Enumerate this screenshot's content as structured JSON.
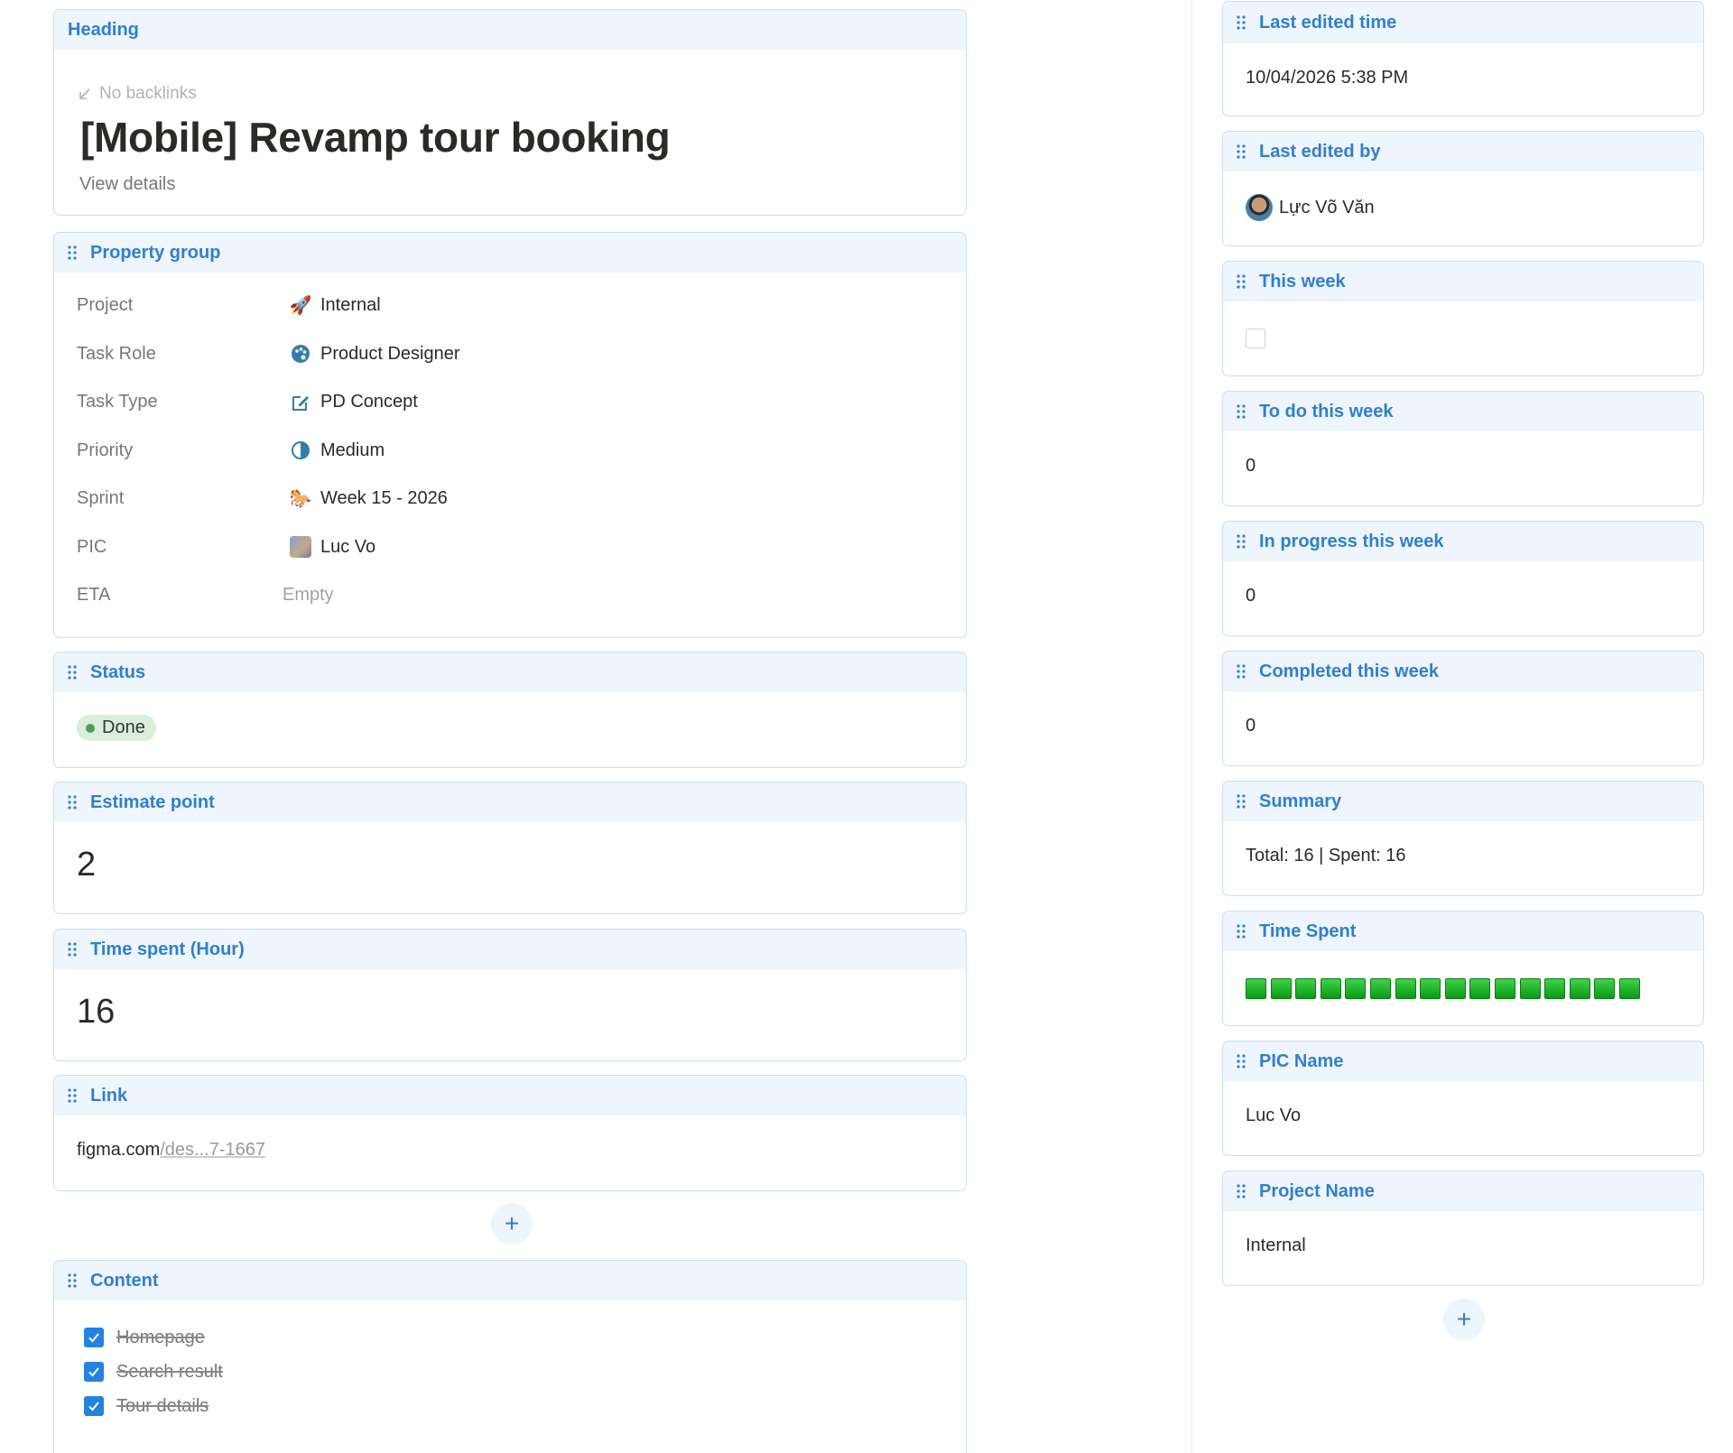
{
  "heading_card": {
    "label": "Heading",
    "backlinks_text": "No backlinks",
    "title": "[Mobile] Revamp tour booking",
    "view_details": "View details"
  },
  "property_group": {
    "label": "Property group",
    "rows": [
      {
        "label": "Project",
        "value": "Internal",
        "icon": "rocket-icon"
      },
      {
        "label": "Task Role",
        "value": "Product Designer",
        "icon": "palette-icon"
      },
      {
        "label": "Task Type",
        "value": "PD Concept",
        "icon": "edit-icon"
      },
      {
        "label": "Priority",
        "value": "Medium",
        "icon": "half-circle-icon"
      },
      {
        "label": "Sprint",
        "value": "Week 15 - 2026",
        "icon": "horse-icon"
      },
      {
        "label": "PIC",
        "value": "Luc Vo",
        "icon": "avatar"
      },
      {
        "label": "ETA",
        "value": "Empty",
        "icon": ""
      }
    ]
  },
  "status": {
    "label": "Status",
    "value": "Done",
    "color": "#dbeddb"
  },
  "estimate": {
    "label": "Estimate point",
    "value": "2"
  },
  "time_spent": {
    "label": "Time spent (Hour)",
    "value": "16"
  },
  "link": {
    "label": "Link",
    "host": "figma.com",
    "path": "/des...7-1667"
  },
  "content": {
    "label": "Content",
    "items": [
      {
        "text": "Homepage",
        "checked": true
      },
      {
        "text": "Search result",
        "checked": true
      },
      {
        "text": "Tour details",
        "checked": true
      }
    ]
  },
  "right": {
    "last_edited_time": {
      "label": "Last edited time",
      "value": "10/04/2026 5:38 PM"
    },
    "last_edited_by": {
      "label": "Last edited by",
      "value": "Lực Võ Văn"
    },
    "this_week": {
      "label": "This week",
      "checked": false
    },
    "todo_this_week": {
      "label": "To do this week",
      "value": "0"
    },
    "in_progress_this_week": {
      "label": "In progress this week",
      "value": "0"
    },
    "completed_this_week": {
      "label": "Completed this week",
      "value": "0"
    },
    "summary": {
      "label": "Summary",
      "value": "Total: 16 | Spent: 16"
    },
    "time_spent_bar": {
      "label": "Time Spent",
      "squares": 16
    },
    "pic_name": {
      "label": "PIC Name",
      "value": "Luc Vo"
    },
    "project_name": {
      "label": "Project Name",
      "value": "Internal"
    }
  },
  "accent_color": "#2f7fcf",
  "add_label": "+"
}
